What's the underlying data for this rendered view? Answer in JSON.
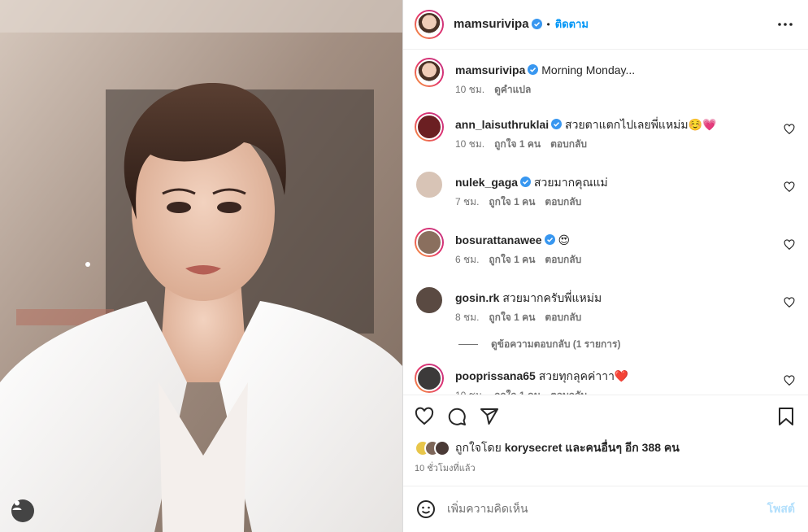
{
  "photo": {
    "subject": "portrait",
    "icon": "user-tag-icon"
  },
  "header": {
    "username": "mamsurivipa",
    "separator": "•",
    "follow_label": "ติดตาม",
    "more_icon": "more-options-icon"
  },
  "caption": {
    "username": "mamsurivipa",
    "text": "Morning Monday...",
    "time": "10 ชม.",
    "translate": "ดูคำแปล"
  },
  "comments": [
    {
      "username": "ann_laisuthruklai",
      "verified": true,
      "text": "สวยตาแตกไปเลยพี่แหม่ม☺️💗",
      "time": "10 ชม.",
      "likes": "ถูกใจ 1 คน",
      "reply": "ตอบกลับ",
      "avatar_color": "#6b1f22"
    },
    {
      "username": "nulek_gaga",
      "verified": true,
      "text": "สวยมากคุณแม่",
      "time": "7 ชม.",
      "likes": "ถูกใจ 1 คน",
      "reply": "ตอบกลับ",
      "avatar_color": "#d8c4b6"
    },
    {
      "username": "bosurattanawee",
      "verified": true,
      "text": "😍",
      "time": "6 ชม.",
      "likes": "ถูกใจ 1 คน",
      "reply": "ตอบกลับ",
      "avatar_color": "#8a6f5e"
    },
    {
      "username": "gosin.rk",
      "verified": false,
      "text": "สวยมากครับพี่แหม่ม",
      "time": "8 ชม.",
      "likes": "ถูกใจ 1 คน",
      "reply": "ตอบกลับ",
      "avatar_color": "#5a4a42"
    }
  ],
  "view_replies": "ดูข้อความตอบกลับ (1 รายการ)",
  "last_comment": {
    "username": "pooprissana65",
    "text": "สวยทุกลุคค่าาา❤️",
    "time": "10 ชม.",
    "likes": "ถูกใจ 1 คน",
    "reply": "ตอบกลับ",
    "avatar_color": "#3c3a3a"
  },
  "actions": {
    "like_icon": "heart-icon",
    "comment_icon": "comment-icon",
    "share_icon": "share-icon",
    "save_icon": "bookmark-icon"
  },
  "likes": {
    "prefix": "ถูกใจโดย",
    "user": "korysecret",
    "middle": "และคนอื่นๆ อีก",
    "count": "388",
    "suffix": "คน"
  },
  "posted_time": "10 ชั่วโมงที่แล้ว",
  "add_comment": {
    "placeholder": "เพิ่มความคิดเห็น",
    "post_label": "โพสต์",
    "emoji_icon": "emoji-icon"
  },
  "colors": {
    "accent": "#0095f6",
    "text": "#262626",
    "muted": "#737373",
    "post_disabled": "#b2dffc",
    "verified": "#3897f0"
  }
}
